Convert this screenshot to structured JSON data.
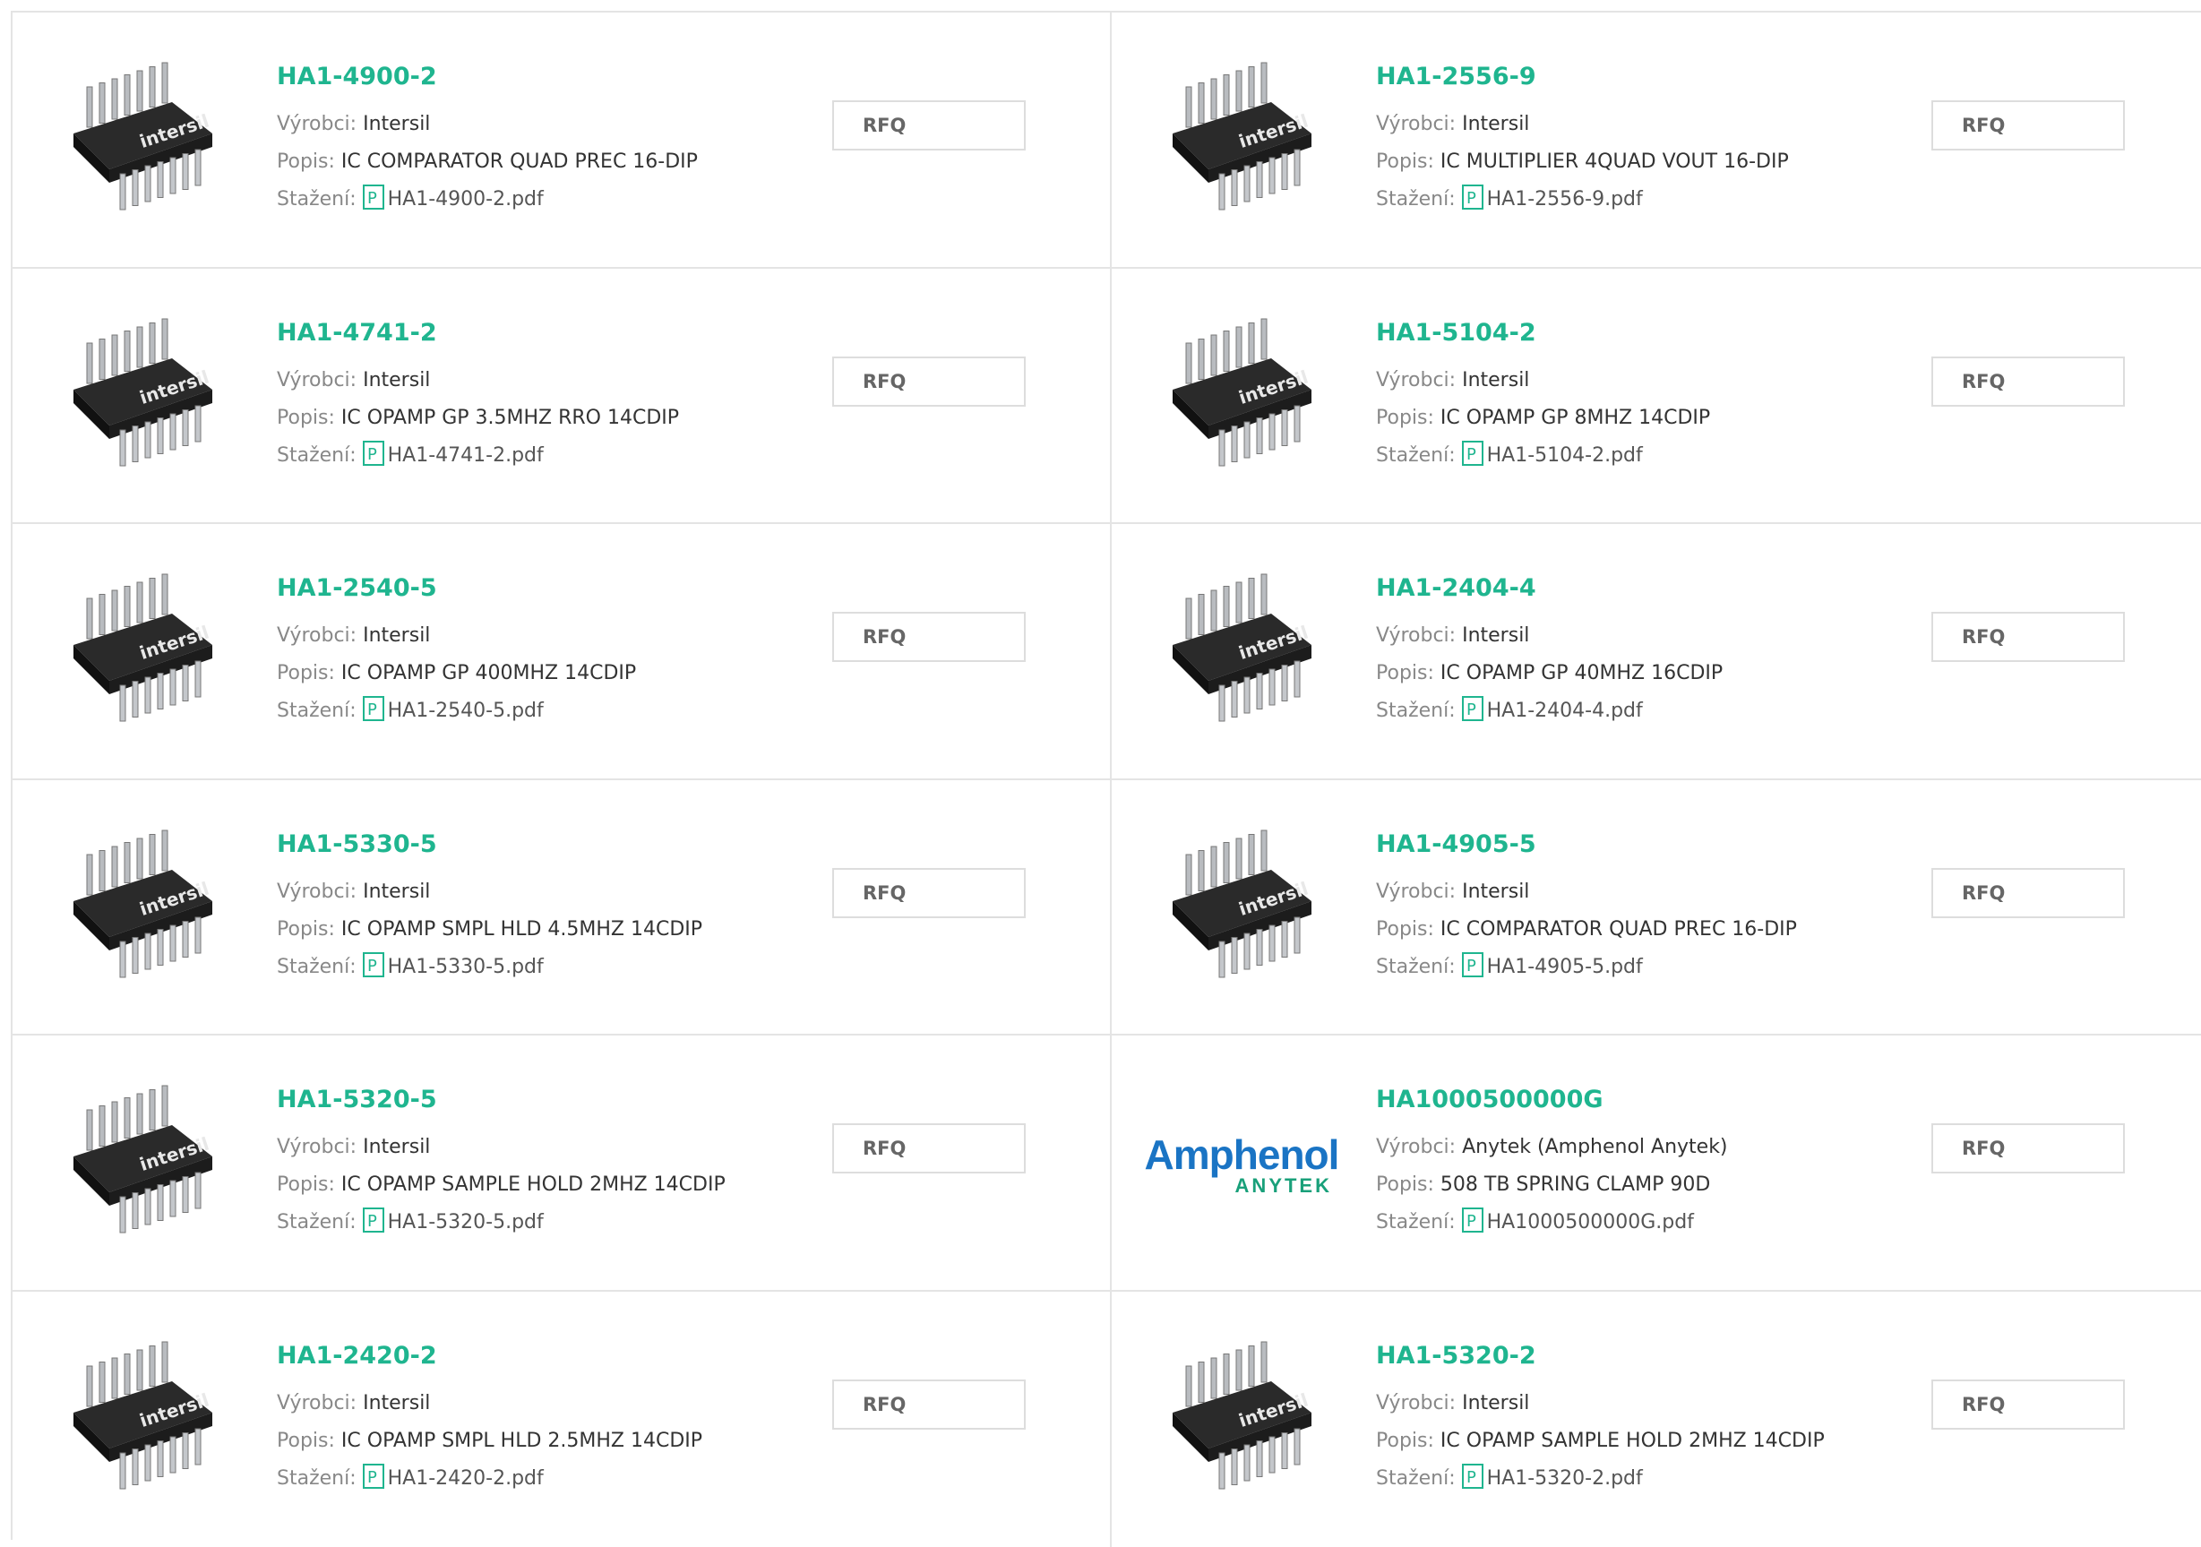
{
  "labels": {
    "manufacturer": "Výrobci:",
    "description": "Popis:",
    "download": "Stažení:",
    "rfq": "RFQ"
  },
  "colors": {
    "accent": "#1fb58f",
    "border": "#e4e4e4"
  },
  "products": [
    {
      "part": "HA1-4900-2",
      "manufacturer": "Intersil",
      "description": "IC COMPARATOR QUAD PREC 16-DIP",
      "file": "HA1-4900-2.pdf",
      "image": "intersil-dip-chip"
    },
    {
      "part": "HA1-2556-9",
      "manufacturer": "Intersil",
      "description": "IC MULTIPLIER 4QUAD VOUT 16-DIP",
      "file": "HA1-2556-9.pdf",
      "image": "intersil-dip-chip"
    },
    {
      "part": "HA1-4741-2",
      "manufacturer": "Intersil",
      "description": "IC OPAMP GP 3.5MHZ RRO 14CDIP",
      "file": "HA1-4741-2.pdf",
      "image": "intersil-dip-chip"
    },
    {
      "part": "HA1-5104-2",
      "manufacturer": "Intersil",
      "description": "IC OPAMP GP 8MHZ 14CDIP",
      "file": "HA1-5104-2.pdf",
      "image": "intersil-dip-chip"
    },
    {
      "part": "HA1-2540-5",
      "manufacturer": "Intersil",
      "description": "IC OPAMP GP 400MHZ 14CDIP",
      "file": "HA1-2540-5.pdf",
      "image": "intersil-dip-chip"
    },
    {
      "part": "HA1-2404-4",
      "manufacturer": "Intersil",
      "description": "IC OPAMP GP 40MHZ 16CDIP",
      "file": "HA1-2404-4.pdf",
      "image": "intersil-dip-chip"
    },
    {
      "part": "HA1-5330-5",
      "manufacturer": "Intersil",
      "description": "IC OPAMP SMPL HLD 4.5MHZ 14CDIP",
      "file": "HA1-5330-5.pdf",
      "image": "intersil-dip-chip"
    },
    {
      "part": "HA1-4905-5",
      "manufacturer": "Intersil",
      "description": "IC COMPARATOR QUAD PREC 16-DIP",
      "file": "HA1-4905-5.pdf",
      "image": "intersil-dip-chip"
    },
    {
      "part": "HA1-5320-5",
      "manufacturer": "Intersil",
      "description": "IC OPAMP SAMPLE HOLD 2MHZ 14CDIP",
      "file": "HA1-5320-5.pdf",
      "image": "intersil-dip-chip"
    },
    {
      "part": "HA1000500000G",
      "manufacturer": "Anytek (Amphenol Anytek)",
      "description": "508 TB SPRING CLAMP 90D",
      "file": "HA1000500000G.pdf",
      "image": "amphenol-anytek-logo",
      "logo_line1": "Amphenol",
      "logo_line2": "ANYTEK"
    },
    {
      "part": "HA1-2420-2",
      "manufacturer": "Intersil",
      "description": "IC OPAMP SMPL HLD 2.5MHZ 14CDIP",
      "file": "HA1-2420-2.pdf",
      "image": "intersil-dip-chip"
    },
    {
      "part": "HA1-5320-2",
      "manufacturer": "Intersil",
      "description": "IC OPAMP SAMPLE HOLD 2MHZ 14CDIP",
      "file": "HA1-5320-2.pdf",
      "image": "intersil-dip-chip"
    }
  ]
}
